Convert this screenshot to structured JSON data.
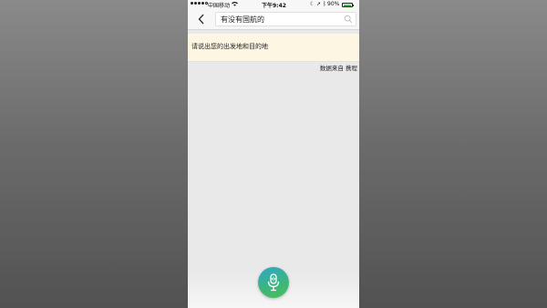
{
  "status_bar": {
    "carrier": "中国移动",
    "time": "下午9:42",
    "battery": "90%"
  },
  "nav": {
    "search_query": "有没有国航的"
  },
  "prompt": {
    "text": "请说出您的出发地和目的地"
  },
  "data_source": {
    "text": "数据来自 携程"
  },
  "colors": {
    "banner_bg": "#fdf6e3",
    "mic_gradient_start": "#2fa7c9",
    "mic_gradient_end": "#4cbf55",
    "battery_fill": "#3cc04a"
  },
  "icons": [
    "signal-icon",
    "wifi-icon",
    "moon-icon",
    "location-icon",
    "bluetooth-icon",
    "battery-icon",
    "back-icon",
    "search-icon",
    "microphone-icon"
  ]
}
